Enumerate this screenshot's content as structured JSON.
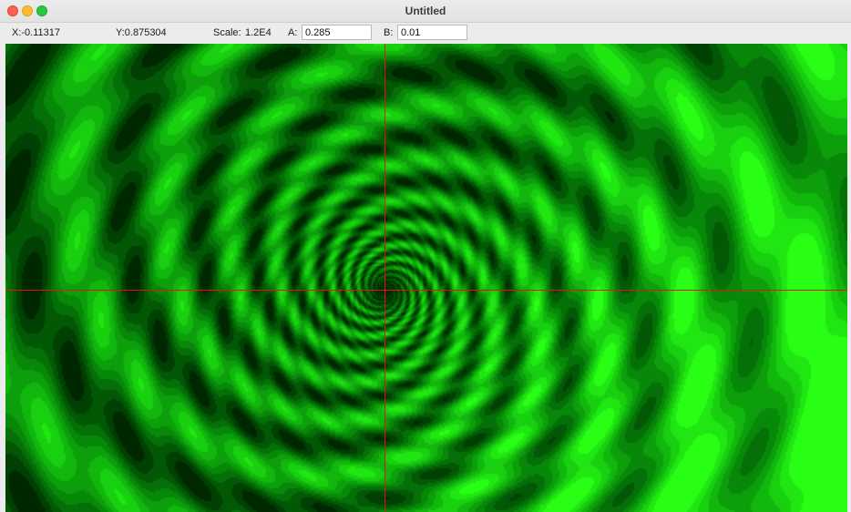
{
  "window": {
    "title": "Untitled"
  },
  "toolbar": {
    "x_text": "X:-0.11317",
    "y_text": "Y:0.875304",
    "scale_label": "Scale:",
    "scale_value": "1.2E4",
    "a_label": "A:",
    "a_value": "0.285",
    "b_label": "B:",
    "b_value": "0.01"
  },
  "fractal": {
    "type": "julia-set",
    "palette": "green",
    "crosshair_color": "#e01515"
  }
}
